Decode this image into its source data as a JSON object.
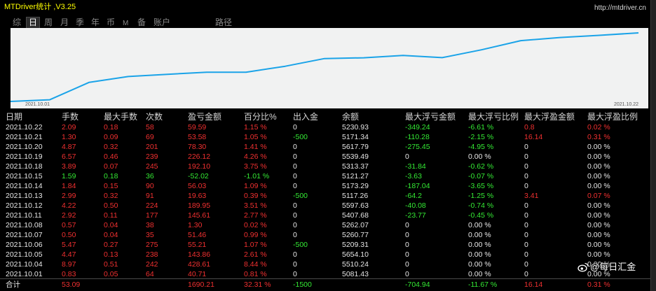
{
  "app": {
    "title": "MTDriver统计 ,V3.25",
    "url": "http://mtdriver.cn"
  },
  "tabs": [
    {
      "label": "综",
      "selected": false
    },
    {
      "label": "日",
      "selected": true
    },
    {
      "label": "周",
      "selected": false
    },
    {
      "label": "月",
      "selected": false
    },
    {
      "label": "季",
      "selected": false
    },
    {
      "label": "年",
      "selected": false
    },
    {
      "label": "币",
      "selected": false
    },
    {
      "label": "M",
      "selected": false
    },
    {
      "label": "备",
      "selected": false
    },
    {
      "label": "账户",
      "selected": false
    },
    {
      "label": "路径",
      "selected": false
    }
  ],
  "colors": {
    "title": "#ffff00",
    "profit": "#f03030",
    "loss": "#34ea34",
    "neutral": "#e6e6e6",
    "line": "#1aa3e8",
    "chart_bg": "#f1f2f2"
  },
  "chart_data": {
    "type": "line",
    "x": [
      "",
      "2021.10.01",
      "",
      "",
      "",
      "",
      "",
      "",
      "",
      "",
      "",
      "",
      "",
      "",
      "",
      "",
      "2021.10.22"
    ],
    "series": [
      {
        "values": [
          0,
          40.71,
          469.32,
          613.18,
          668.39,
          719.85,
          721.15,
          866.76,
          1056.71,
          1076.34,
          1132.37,
          1080.35,
          1272.45,
          1498.57,
          1576.87,
          1630.45,
          1690.21
        ]
      }
    ],
    "grid": false
  },
  "table": {
    "columns": [
      "日期",
      "手数",
      "最大手数",
      "次数",
      "盈亏金额",
      "百分比%",
      "出入金",
      "余额",
      "最大浮亏金额",
      "最大浮亏比例",
      "最大浮盈金额",
      "最大浮盈比例"
    ],
    "rows": [
      [
        "2021.10.22",
        "2.09",
        "0.18",
        "58",
        "59.59",
        "1.15 %",
        "0",
        "5230.93",
        "-349.24",
        "-6.61 %",
        "0.8",
        "0.02 %"
      ],
      [
        "2021.10.21",
        "1.30",
        "0.09",
        "69",
        "53.58",
        "1.05 %",
        "-500",
        "5171.34",
        "-110.28",
        "-2.15 %",
        "16.14",
        "0.31 %"
      ],
      [
        "2021.10.20",
        "4.87",
        "0.32",
        "201",
        "78.30",
        "1.41 %",
        "0",
        "5617.79",
        "-275.45",
        "-4.95 %",
        "0",
        "0.00 %"
      ],
      [
        "2021.10.19",
        "6.57",
        "0.46",
        "239",
        "226.12",
        "4.26 %",
        "0",
        "5539.49",
        "0",
        "0.00 %",
        "0",
        "0.00 %"
      ],
      [
        "2021.10.18",
        "3.89",
        "0.07",
        "245",
        "192.10",
        "3.75 %",
        "0",
        "5313.37",
        "-31.84",
        "-0.62 %",
        "0",
        "0.00 %"
      ],
      [
        "2021.10.15",
        "1.59",
        "0.18",
        "36",
        "-52.02",
        "-1.01 %",
        "0",
        "5121.27",
        "-3.63",
        "-0.07 %",
        "0",
        "0.00 %"
      ],
      [
        "2021.10.14",
        "1.84",
        "0.15",
        "90",
        "56.03",
        "1.09 %",
        "0",
        "5173.29",
        "-187.04",
        "-3.65 %",
        "0",
        "0.00 %"
      ],
      [
        "2021.10.13",
        "2.99",
        "0.32",
        "91",
        "19.63",
        "0.39 %",
        "-500",
        "5117.26",
        "-64.2",
        "-1.25 %",
        "3.41",
        "0.07 %"
      ],
      [
        "2021.10.12",
        "4.22",
        "0.50",
        "224",
        "189.95",
        "3.51 %",
        "0",
        "5597.63",
        "-40.08",
        "-0.74 %",
        "0",
        "0.00 %"
      ],
      [
        "2021.10.11",
        "2.92",
        "0.11",
        "177",
        "145.61",
        "2.77 %",
        "0",
        "5407.68",
        "-23.77",
        "-0.45 %",
        "0",
        "0.00 %"
      ],
      [
        "2021.10.08",
        "0.57",
        "0.04",
        "38",
        "1.30",
        "0.02 %",
        "0",
        "5262.07",
        "0",
        "0.00 %",
        "0",
        "0.00 %"
      ],
      [
        "2021.10.07",
        "0.50",
        "0.04",
        "35",
        "51.46",
        "0.99 %",
        "0",
        "5260.77",
        "0",
        "0.00 %",
        "0",
        "0.00 %"
      ],
      [
        "2021.10.06",
        "5.47",
        "0.27",
        "275",
        "55.21",
        "1.07 %",
        "-500",
        "5209.31",
        "0",
        "0.00 %",
        "0",
        "0.00 %"
      ],
      [
        "2021.10.05",
        "4.47",
        "0.13",
        "238",
        "143.86",
        "2.61 %",
        "0",
        "5654.10",
        "0",
        "0.00 %",
        "0",
        "0.00 %"
      ],
      [
        "2021.10.04",
        "8.97",
        "0.51",
        "242",
        "428.61",
        "8.44 %",
        "0",
        "5510.24",
        "0",
        "0.00 %",
        "0",
        "0.00 %"
      ],
      [
        "2021.10.01",
        "0.83",
        "0.05",
        "64",
        "40.71",
        "0.81 %",
        "0",
        "5081.43",
        "0",
        "0.00 %",
        "0",
        "0.00 %"
      ]
    ],
    "total": [
      "合计",
      "53.09",
      "",
      "",
      "1690.21",
      "32.31 %",
      "-1500",
      "",
      "-704.94",
      "-11.67 %",
      "16.14",
      "0.31 %"
    ]
  },
  "watermark": {
    "text": "@每日汇金",
    "icon": "weibo-logo-icon"
  }
}
